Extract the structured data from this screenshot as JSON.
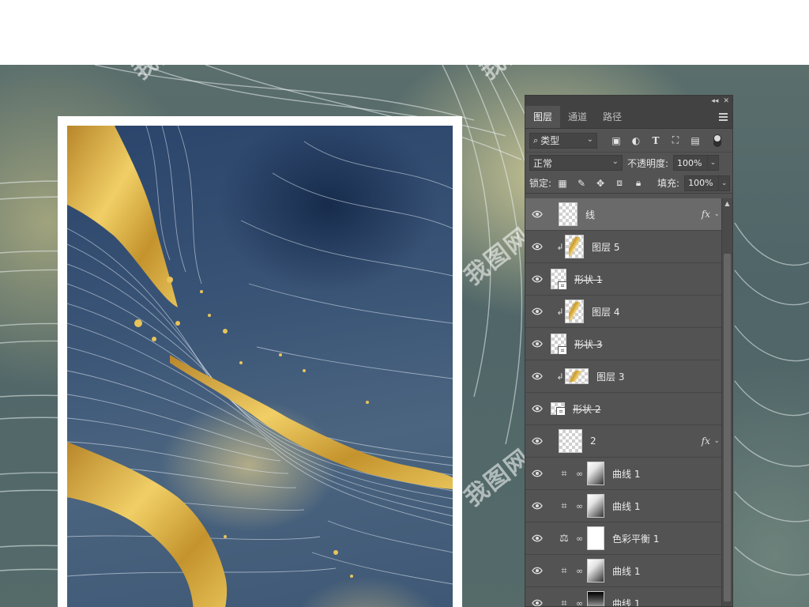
{
  "watermark": "我图网",
  "panel": {
    "tabs": [
      {
        "label": "图层",
        "active": true
      },
      {
        "label": "通道",
        "active": false
      },
      {
        "label": "路径",
        "active": false
      }
    ],
    "filter": {
      "kind_label": "类型"
    },
    "blend": {
      "mode": "正常",
      "opacity_label": "不透明度:",
      "opacity_value": "100%"
    },
    "lock": {
      "label": "锁定:",
      "fill_label": "填充:",
      "fill_value": "100%"
    },
    "layers": [
      {
        "name": "线",
        "type": "pixel",
        "selected": true,
        "fx": true
      },
      {
        "name": "图层 5",
        "type": "clipped-pixel"
      },
      {
        "name": "形状 1",
        "type": "shape",
        "strike": true
      },
      {
        "name": "图层 4",
        "type": "clipped-pixel"
      },
      {
        "name": "形状 3",
        "type": "shape",
        "strike": true
      },
      {
        "name": "图层 3",
        "type": "clipped-pixel-wide"
      },
      {
        "name": "形状 2",
        "type": "shape-wide",
        "strike": true
      },
      {
        "name": "2",
        "type": "pixel-big",
        "fx": true
      },
      {
        "name": "曲线 1",
        "type": "curves"
      },
      {
        "name": "曲线 1",
        "type": "curves"
      },
      {
        "name": "色彩平衡 1",
        "type": "color-balance"
      },
      {
        "name": "曲线 1",
        "type": "curves"
      },
      {
        "name": "曲线 1",
        "type": "curves"
      }
    ],
    "fx_label": "fx",
    "colors": {
      "panel_bg": "#535353",
      "tab_bar": "#424242",
      "selected_row": "#6a6a6a"
    }
  }
}
